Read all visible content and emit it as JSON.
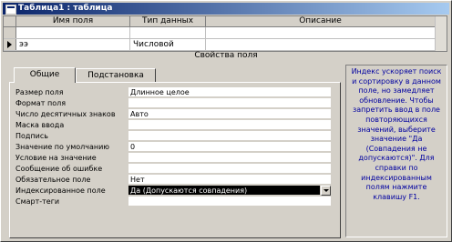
{
  "window": {
    "title": "Таблица1 : таблица"
  },
  "grid": {
    "headers": [
      "Имя поля",
      "Тип данных",
      "Описание"
    ],
    "rows": [
      {
        "name": "",
        "type": "",
        "description": ""
      },
      {
        "name": "ээ",
        "type": "Числовой",
        "description": ""
      }
    ]
  },
  "section_label": "Свойства поля",
  "tabs": [
    {
      "label": "Общие",
      "active": true
    },
    {
      "label": "Подстановка",
      "active": false
    }
  ],
  "properties": [
    {
      "label": "Размер поля",
      "value": "Длинное целое"
    },
    {
      "label": "Формат поля",
      "value": ""
    },
    {
      "label": "Число десятичных знаков",
      "value": "Авто"
    },
    {
      "label": "Маска ввода",
      "value": ""
    },
    {
      "label": "Подпись",
      "value": ""
    },
    {
      "label": "Значение по умолчанию",
      "value": "0"
    },
    {
      "label": "Условие на значение",
      "value": ""
    },
    {
      "label": "Сообщение об ошибке",
      "value": ""
    },
    {
      "label": "Обязательное поле",
      "value": "Нет"
    },
    {
      "label": "Индексированное поле",
      "value": "Да (Допускаются совпадения)"
    },
    {
      "label": "Смарт-теги",
      "value": ""
    }
  ],
  "help_text": "Индекс ускоряет поиск и сортировку в данном поле, но замедляет обновление. Чтобы запретить ввод в поле повторяющихся значений, выберите значение \"Да (Совпадения не допускаются)\". Для справки по индексированным полям нажмите клавишу F1."
}
